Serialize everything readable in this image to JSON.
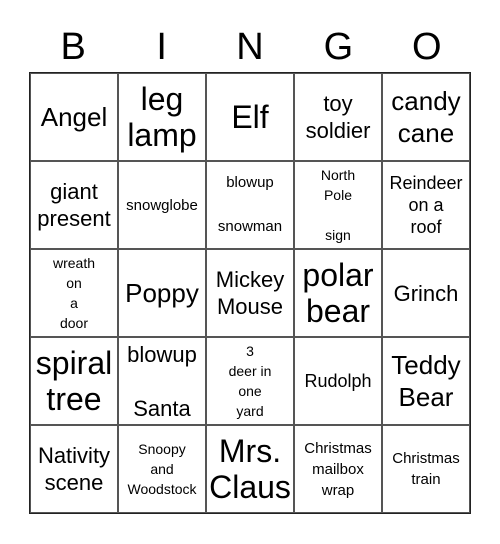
{
  "header": {
    "letters": [
      "B",
      "I",
      "N",
      "G",
      "O"
    ]
  },
  "cells": [
    [
      "Angel",
      "leg\nlamp",
      "Elf",
      "toy\nsoldier",
      "candy\ncane"
    ],
    [
      "giant\npresent",
      "snowglobe",
      "blowup\n\nsnowman",
      "North\nPole\n\nsign",
      "Reindeer\non a\nroof"
    ],
    [
      "wreath\non\na\ndoor",
      "Poppy",
      "Mickey\nMouse",
      "polar\nbear",
      "Grinch"
    ],
    [
      "spiral\ntree",
      "blowup\n\nSanta",
      "3\ndeer in\none\nyard",
      "Rudolph",
      "Teddy\nBear"
    ],
    [
      "Nativity\nscene",
      "Snoopy\nand\nWoodstock",
      "Mrs.\nClaus",
      "Christmas\nmailbox\nwrap",
      "Christmas\ntrain"
    ]
  ]
}
